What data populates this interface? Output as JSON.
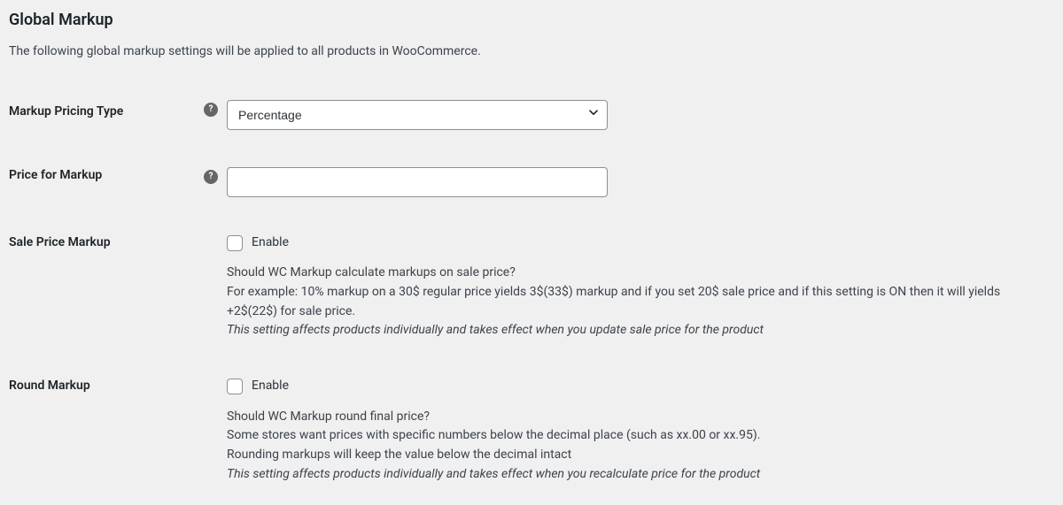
{
  "section": {
    "title": "Global Markup",
    "description": "The following global markup settings will be applied to all products in WooCommerce."
  },
  "fields": {
    "pricing_type": {
      "label": "Markup Pricing Type",
      "selected": "Percentage"
    },
    "price_for_markup": {
      "label": "Price for Markup",
      "value": ""
    },
    "sale_price_markup": {
      "label": "Sale Price Markup",
      "checkbox_label": "Enable",
      "desc_line1": "Should WC Markup calculate markups on sale price?",
      "desc_line2": "For example: 10% markup on a 30$ regular price yields 3$(33$) markup and if you set 20$ sale price and if this setting is ON then it will yields +2$(22$) for sale price.",
      "desc_italic": "This setting affects products individually and takes effect when you update sale price for the product"
    },
    "round_markup": {
      "label": "Round Markup",
      "checkbox_label": "Enable",
      "desc_line1": "Should WC Markup round final price?",
      "desc_line2": "Some stores want prices with specific numbers below the decimal place (such as xx.00 or xx.95).",
      "desc_line3": "Rounding markups will keep the value below the decimal intact",
      "desc_italic": "This setting affects products individually and takes effect when you recalculate price for the product"
    }
  },
  "help_glyph": "?"
}
